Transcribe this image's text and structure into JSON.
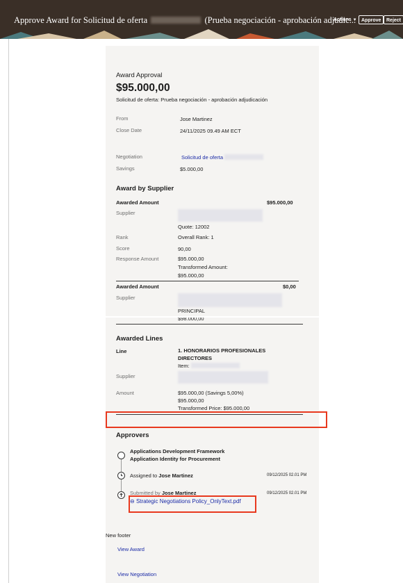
{
  "header": {
    "title_prefix": "Approve Award for Solicitud de oferta",
    "title_suffix": "(Prueba negociación - aprobación adjudic...",
    "actions_label": "Actions",
    "approve_label": "Approve",
    "reject_label": "Reject"
  },
  "award": {
    "heading": "Award Approval",
    "amount": "$95.000,00",
    "subtitle": "Solicitud de oferta: Prueba negociación - aprobación adjudicación",
    "from_label": "From",
    "from_value": "Jose  Martinez",
    "close_date_label": "Close Date",
    "close_date_value": "24/11/2025 09.49 AM ECT",
    "negotiation_label": "Negotiation",
    "negotiation_link": "Solicitud de oferta",
    "savings_label": "Savings",
    "savings_value": "$5.000,00"
  },
  "by_supplier": {
    "heading": "Award by Supplier",
    "entry1": {
      "awarded_label": "Awarded Amount",
      "awarded_value": "$95.000,00",
      "supplier_label": "Supplier",
      "quote": "Quote: 12002",
      "rank_label": "Rank",
      "rank_value": "Overall Rank: 1",
      "score_label": "Score",
      "score_value": "90,00",
      "response_label": "Response Amount",
      "response_value": "$95.000,00",
      "transformed_label": "Transformed Amount:",
      "transformed_value": "$95.000,00"
    },
    "entry2": {
      "awarded_label": "Awarded Amount",
      "awarded_value": "$0,00",
      "supplier_label": "Supplier",
      "principal": "PRINCIPAL",
      "amount": "$98.000,00"
    }
  },
  "lines": {
    "heading": "Awarded Lines",
    "line_label": "Line",
    "line_value_1": "1. HONORARIOS PROFESIONALES",
    "line_value_2": "DIRECTORES",
    "item_label": "Item:",
    "supplier_label": "Supplier",
    "amount_label": "Amount",
    "amount_value": "$95.000,00 (Savings 5,00%)",
    "amount_value_2": "$95.000,00",
    "transformed_price": "Transformed Price: $95.000,00"
  },
  "approvers": {
    "heading": "Approvers",
    "group_line1": "Applications Development Framework",
    "group_line2": "Application Identity for Procurement",
    "assigned_prefix": "Assigned to",
    "assigned_name": "Jose Martinez",
    "assigned_time": "09/12/2025 02.01 PM",
    "submitted_prefix": "Submitted by",
    "submitted_name": "Jose Martinez",
    "submitted_time": "09/12/2025 02.01 PM",
    "attachment": "Strategic Negotiations Policy_OnlyText.pdf"
  },
  "footer": {
    "text": "New footer",
    "view_award": "View Award",
    "view_negotiation": "View Negotiation"
  },
  "colors": {
    "header_bg": "#3a2f27",
    "highlight": "#e8381e",
    "link": "#1a2aa6",
    "card_bg": "#f5f4f2"
  }
}
